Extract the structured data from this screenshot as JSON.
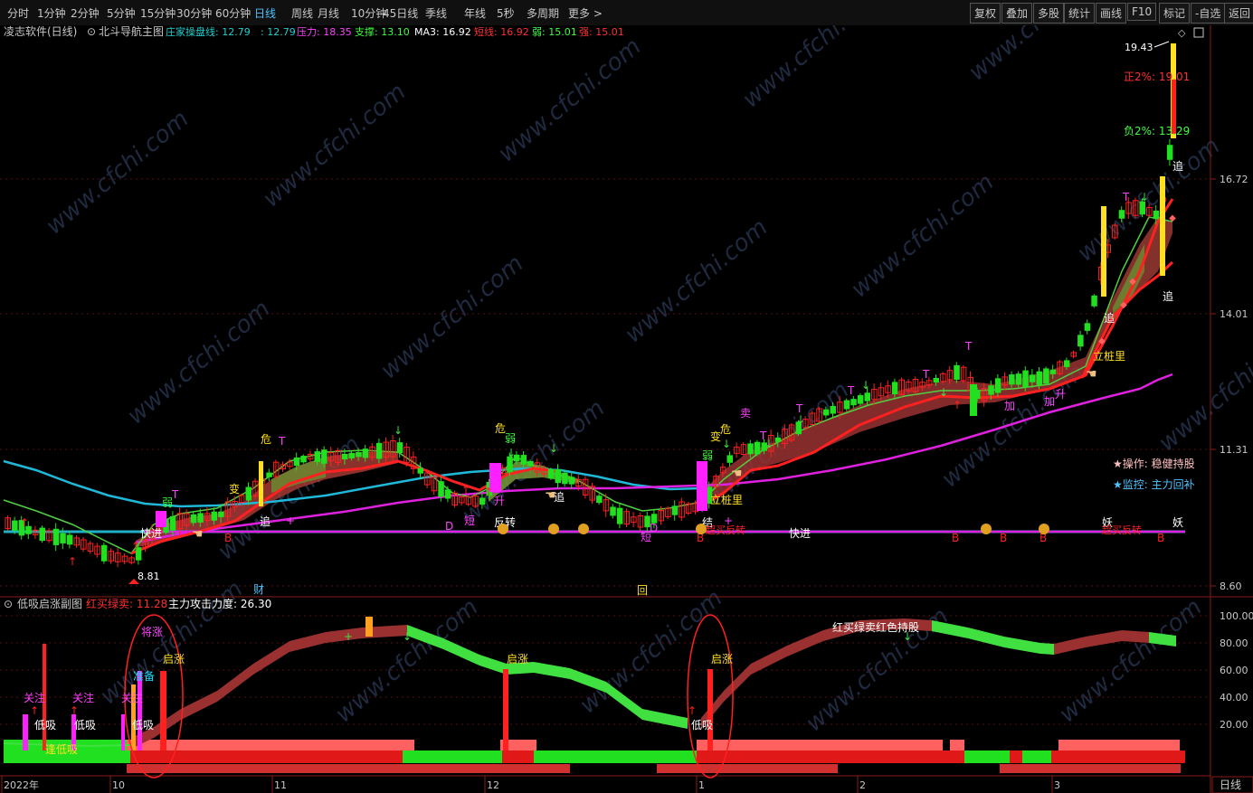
{
  "toolbar": {
    "periods": [
      "分时",
      "1分钟",
      "2分钟",
      "5分钟",
      "15分钟",
      "30分钟",
      "60分钟",
      "日线",
      "周线",
      "月线",
      "10分钟",
      "45日线",
      "季线",
      "年线",
      "5秒",
      "多周期",
      "更多 >"
    ],
    "active": "日线",
    "right_buttons": [
      "复权",
      "叠加",
      "多股",
      "统计",
      "画线",
      "F10",
      "标记",
      "-自选",
      "返回"
    ]
  },
  "main_panel": {
    "title": "凌志软件(日线)",
    "indicator": "北斗导航主图",
    "legend": [
      {
        "text": "庄家操盘线: 12.79",
        "color": "#20d0d0"
      },
      {
        "text": ": 12.79",
        "color": "#20d0d0"
      },
      {
        "text": "压力: 18.35",
        "color": "#ff40ff"
      },
      {
        "text": "支撑: 13.10",
        "color": "#40ff40"
      },
      {
        "text": "MA3: 16.92",
        "color": "#ffffff"
      },
      {
        "text": "短线: 16.92",
        "color": "#ff3030"
      },
      {
        "text": "弱: 15.01",
        "color": "#40ff40"
      },
      {
        "text": "强: 15.01",
        "color": "#ff3030"
      }
    ],
    "price_axis": [
      "16.72",
      "14.01",
      "11.31",
      "8.60"
    ],
    "high_label": "19.43",
    "low_label": "8.81",
    "zheng_label": "正2%: 19.01",
    "fu_label": "负2%: 13.29",
    "operation": "★操作: 稳健持股",
    "monitor": "★监控: 主力回补",
    "annotations": [
      "追",
      "追",
      "立桩里",
      "立桩里",
      "危",
      "弱",
      "变",
      "危",
      "弱",
      "变",
      "卖",
      "升",
      "追",
      "短",
      "反转",
      "快进",
      "快进",
      "财",
      "回",
      "B",
      "B",
      "B",
      "B",
      "B",
      "妖",
      "妖",
      "加",
      "加",
      "升",
      "T",
      "T",
      "D",
      "D",
      "D"
    ]
  },
  "sub_panel": {
    "title": "低吸启涨副图",
    "legend": [
      {
        "text": "红买绿卖: 11.28",
        "color": "#ff3030"
      },
      {
        "text": "主力攻击力度: 26.30",
        "color": "#ffffff"
      }
    ],
    "axis": [
      "100.00",
      "80.00",
      "60.00",
      "40.00",
      "20.00"
    ],
    "annotations": [
      "关注",
      "关注",
      "关注",
      "低吸",
      "低吸",
      "低吸",
      "低吸",
      "准备",
      "将涨",
      "启涨",
      "启涨",
      "启涨",
      "逢低吸",
      "红买绿卖红色持股"
    ]
  },
  "x_axis": [
    "2022年",
    "10",
    "11",
    "12",
    "1",
    "2",
    "3"
  ],
  "corner": "日线",
  "watermark": "www.cfchi.com"
}
